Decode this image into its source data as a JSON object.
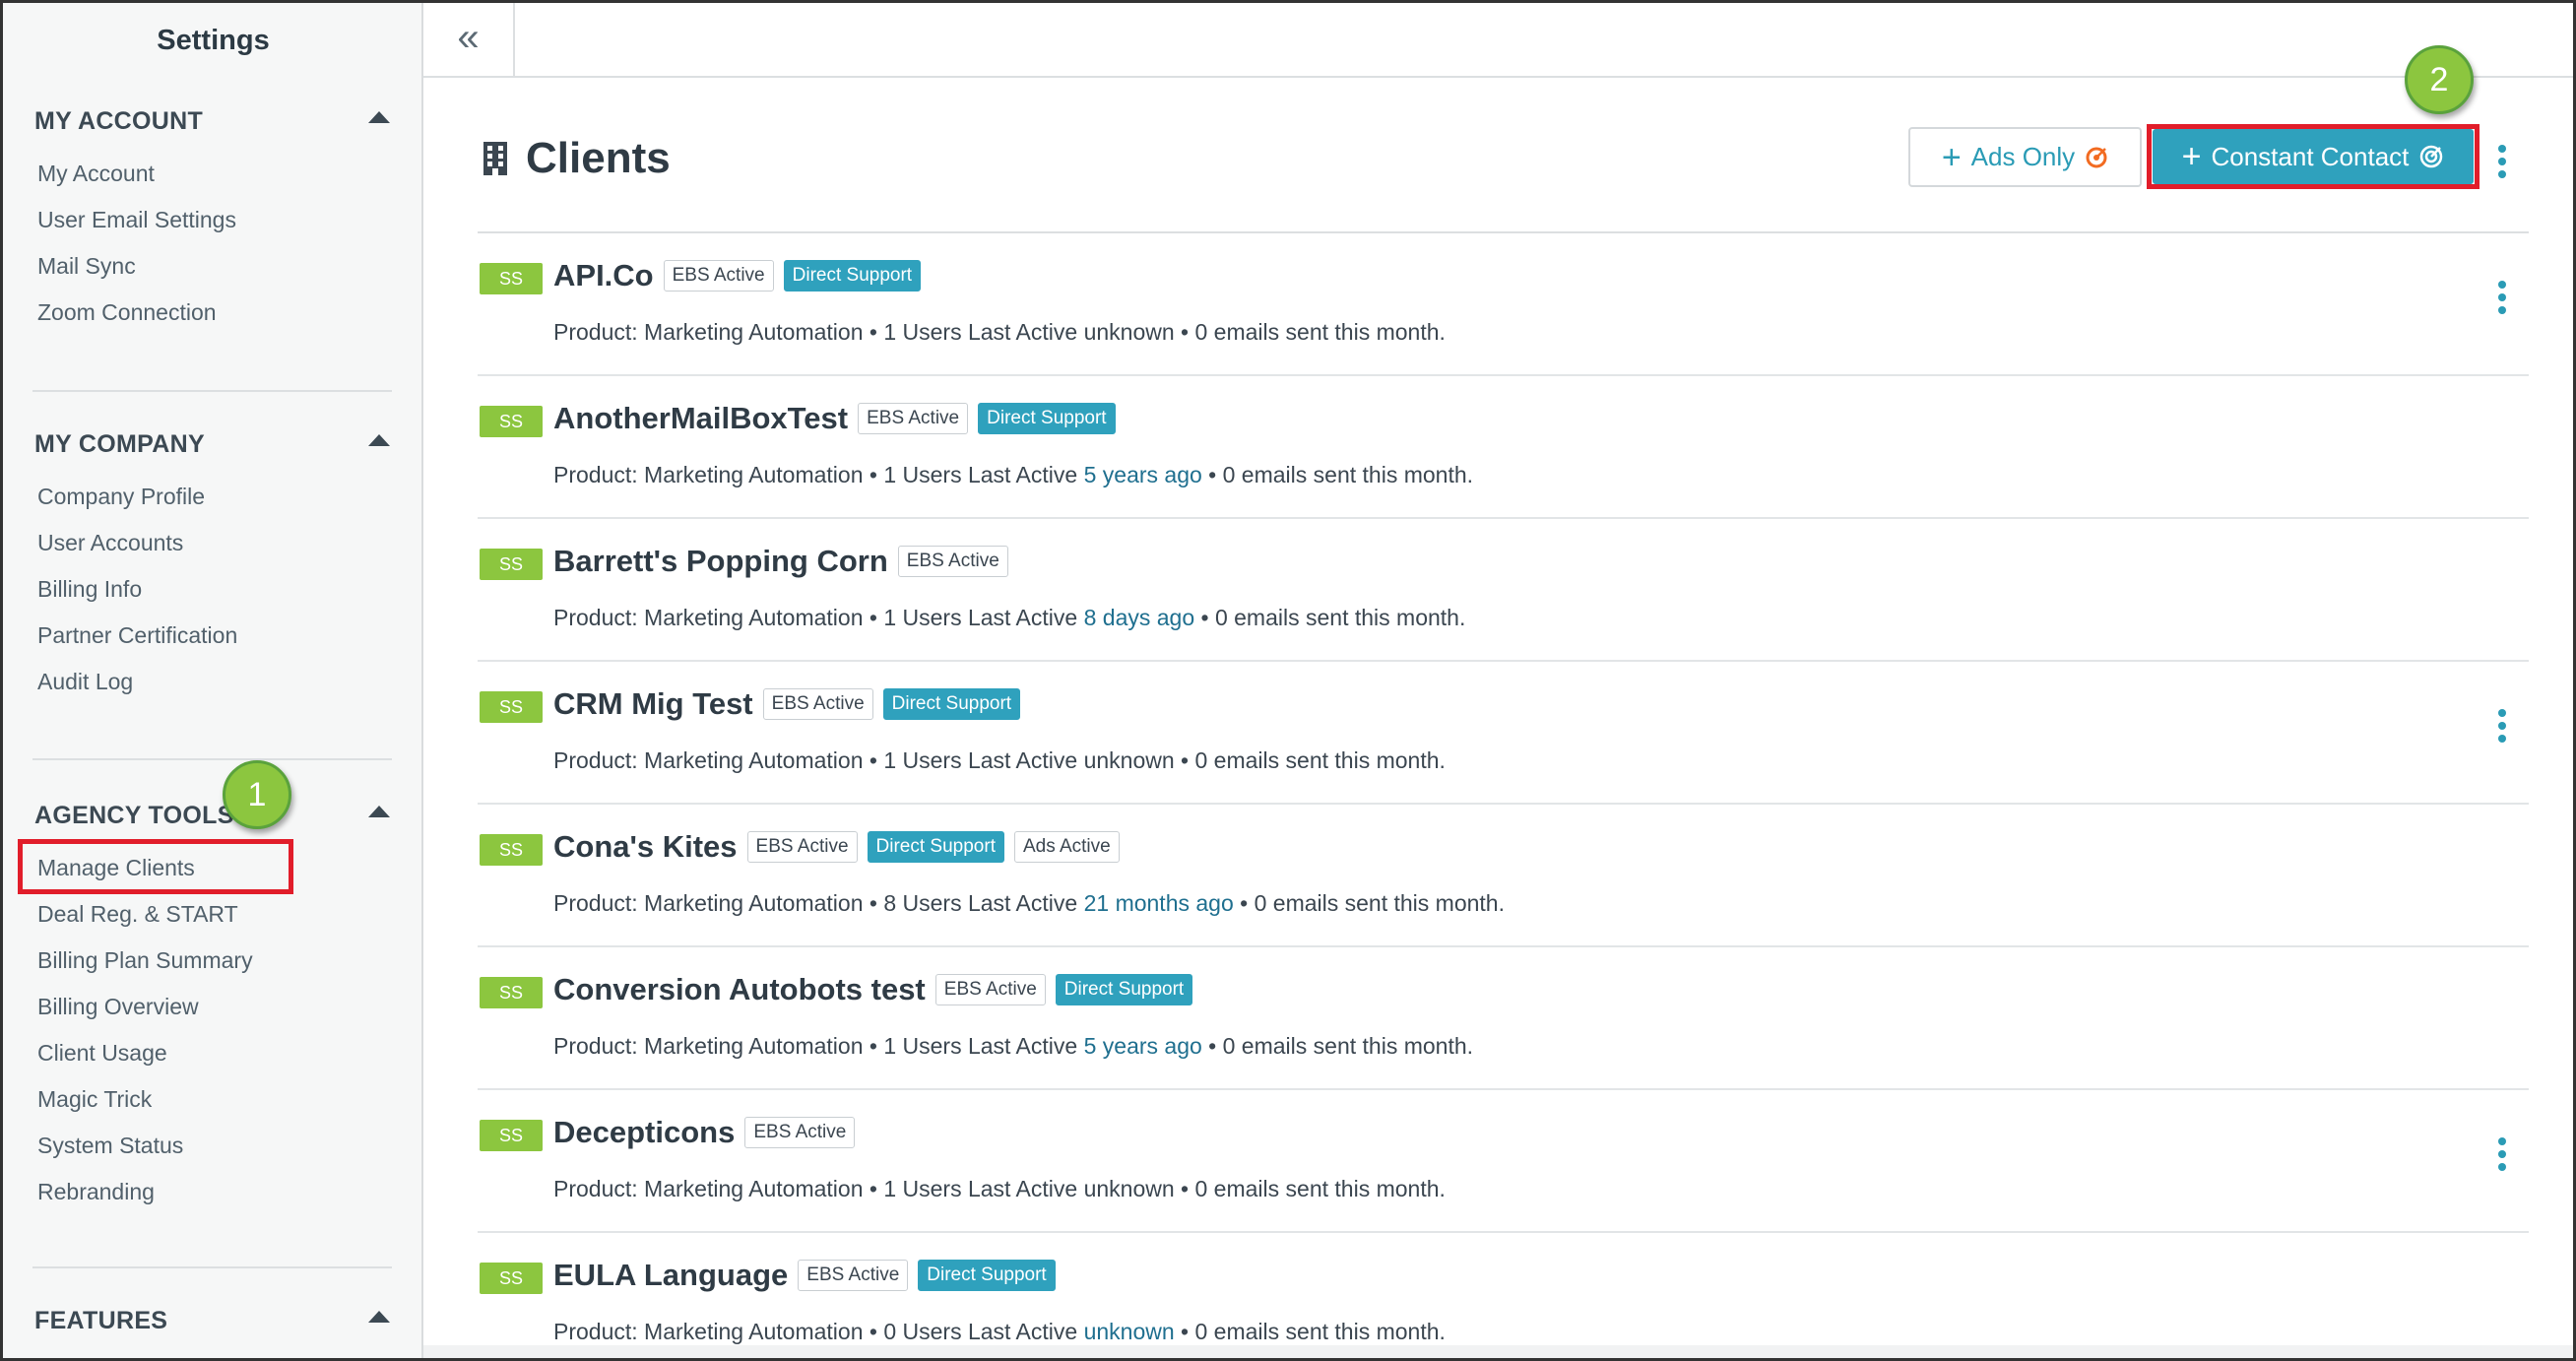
{
  "sidebar": {
    "title": "Settings",
    "sections": [
      {
        "title": "MY ACCOUNT",
        "items": [
          "My Account",
          "User Email Settings",
          "Mail Sync",
          "Zoom Connection"
        ]
      },
      {
        "title": "MY COMPANY",
        "items": [
          "Company Profile",
          "User Accounts",
          "Billing Info",
          "Partner Certification",
          "Audit Log"
        ]
      },
      {
        "title": "AGENCY TOOLS",
        "items": [
          "Manage Clients",
          "Deal Reg. & START",
          "Billing Plan Summary",
          "Billing Overview",
          "Client Usage",
          "Magic Trick",
          "System Status",
          "Rebranding"
        ]
      },
      {
        "title": "FEATURES",
        "items": []
      }
    ]
  },
  "topbar": {
    "collapse_glyph": "«"
  },
  "callouts": {
    "one": "1",
    "two": "2"
  },
  "main": {
    "title": "Clients",
    "title_icon": "building-icon",
    "ads_only_label": "Ads Only",
    "constant_contact_label": "Constant Contact",
    "accent_color": "#2fa1bd",
    "ss_badge_color": "#8cc63f",
    "highlight_color": "#e11d2a"
  },
  "clients": [
    {
      "badge": "SS",
      "name": "API.Co",
      "tags": [
        {
          "text": "EBS Active",
          "style": "outline"
        },
        {
          "text": "Direct Support",
          "style": "teal"
        }
      ],
      "meta_a": "Product: Marketing Automation • 1 Users Last Active ",
      "last_active": "unknown",
      "last_active_link": false,
      "meta_b": " • 0 emails sent this month.",
      "has_menu": true
    },
    {
      "badge": "SS",
      "name": "AnotherMailBoxTest",
      "tags": [
        {
          "text": "EBS Active",
          "style": "outline"
        },
        {
          "text": "Direct Support",
          "style": "teal"
        }
      ],
      "meta_a": "Product: Marketing Automation • 1 Users Last Active ",
      "last_active": "5 years ago",
      "last_active_link": true,
      "meta_b": " • 0 emails sent this month.",
      "has_menu": false
    },
    {
      "badge": "SS",
      "name": "Barrett's Popping Corn",
      "tags": [
        {
          "text": "EBS Active",
          "style": "outline"
        }
      ],
      "meta_a": "Product: Marketing Automation • 1 Users Last Active ",
      "last_active": "8 days ago",
      "last_active_link": true,
      "meta_b": " • 0 emails sent this month.",
      "has_menu": false
    },
    {
      "badge": "SS",
      "name": "CRM Mig Test",
      "tags": [
        {
          "text": "EBS Active",
          "style": "outline"
        },
        {
          "text": "Direct Support",
          "style": "teal"
        }
      ],
      "meta_a": "Product: Marketing Automation • 1 Users Last Active ",
      "last_active": "unknown",
      "last_active_link": false,
      "meta_b": " • 0 emails sent this month.",
      "has_menu": true
    },
    {
      "badge": "SS",
      "name": "Cona's Kites",
      "tags": [
        {
          "text": "EBS Active",
          "style": "outline"
        },
        {
          "text": "Direct Support",
          "style": "teal"
        },
        {
          "text": "Ads Active",
          "style": "outline"
        }
      ],
      "meta_a": "Product: Marketing Automation • 8 Users Last Active ",
      "last_active": "21 months ago",
      "last_active_link": true,
      "meta_b": " • 0 emails sent this month.",
      "has_menu": false
    },
    {
      "badge": "SS",
      "name": "Conversion Autobots test",
      "tags": [
        {
          "text": "EBS Active",
          "style": "outline"
        },
        {
          "text": "Direct Support",
          "style": "teal"
        }
      ],
      "meta_a": "Product: Marketing Automation • 1 Users Last Active ",
      "last_active": "5 years ago",
      "last_active_link": true,
      "meta_b": " • 0 emails sent this month.",
      "has_menu": false
    },
    {
      "badge": "SS",
      "name": "Decepticons",
      "tags": [
        {
          "text": "EBS Active",
          "style": "outline"
        }
      ],
      "meta_a": "Product: Marketing Automation • 1 Users Last Active ",
      "last_active": "unknown",
      "last_active_link": false,
      "meta_b": " • 0 emails sent this month.",
      "has_menu": true
    },
    {
      "badge": "SS",
      "name": "EULA Language",
      "tags": [
        {
          "text": "EBS Active",
          "style": "outline"
        },
        {
          "text": "Direct Support",
          "style": "teal"
        }
      ],
      "meta_a": "Product: Marketing Automation • 0 Users Last Active ",
      "last_active": "unknown",
      "last_active_link": true,
      "meta_b": " • 0 emails sent this month.",
      "has_menu": false
    }
  ]
}
